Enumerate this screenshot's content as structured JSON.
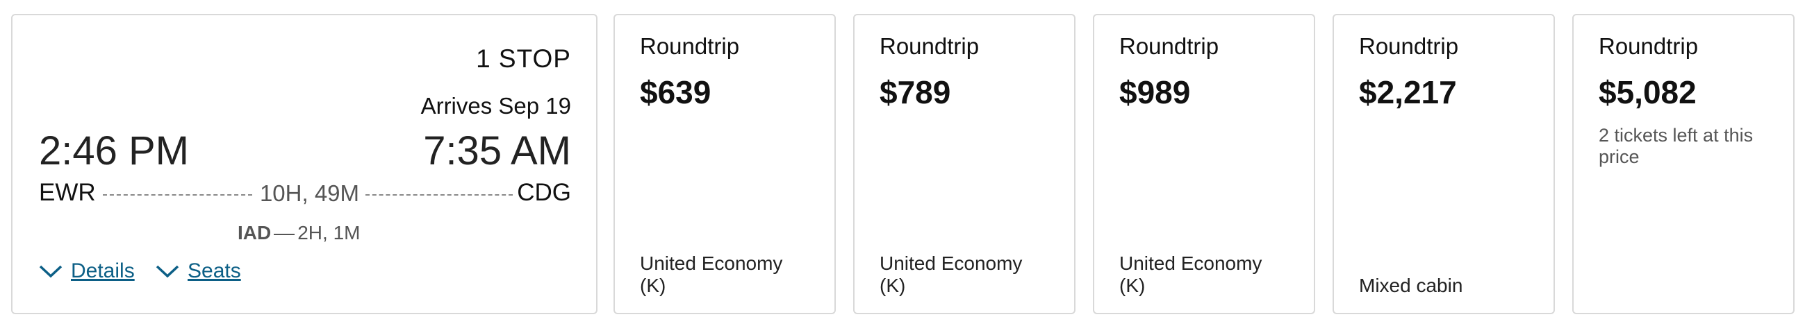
{
  "flight": {
    "stops": "1 STOP",
    "arrives": "Arrives Sep 19",
    "depart_time": "2:46 PM",
    "arrive_time": "7:35 AM",
    "origin": "EWR",
    "destination": "CDG",
    "duration": "10H, 49M",
    "layover_airport": "IAD",
    "layover_duration": "2H, 1M",
    "details_label": "Details",
    "seats_label": "Seats",
    "link_color": "#0c5f86"
  },
  "fares": [
    {
      "label": "Roundtrip",
      "price": "$639",
      "note": "",
      "cabin_line1": "United Economy",
      "cabin_line2": "(K)"
    },
    {
      "label": "Roundtrip",
      "price": "$789",
      "note": "",
      "cabin_line1": "United Economy",
      "cabin_line2": "(K)"
    },
    {
      "label": "Roundtrip",
      "price": "$989",
      "note": "",
      "cabin_line1": "United Economy",
      "cabin_line2": "(K)"
    },
    {
      "label": "Roundtrip",
      "price": "$2,217",
      "note": "",
      "cabin_line1": "Mixed cabin",
      "cabin_line2": ""
    },
    {
      "label": "Roundtrip",
      "price": "$5,082",
      "note": "2 tickets left at this price",
      "cabin_line1": "",
      "cabin_line2": ""
    }
  ]
}
